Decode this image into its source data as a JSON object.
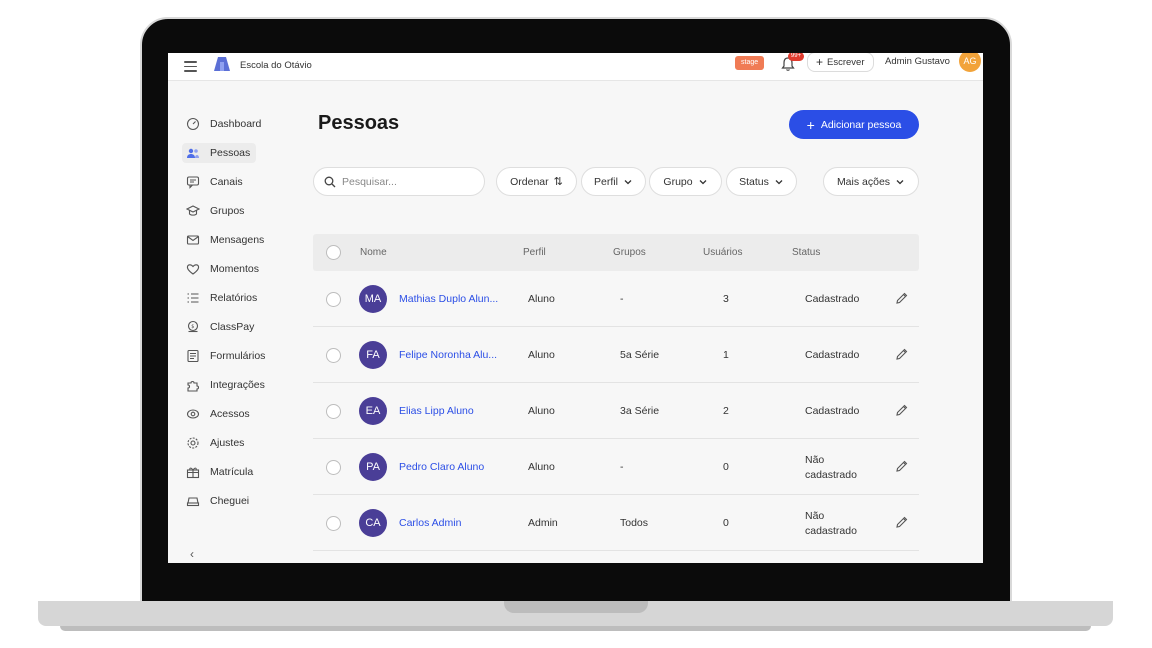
{
  "topbar": {
    "school_name": "Escola do Otávio",
    "stage_label": "stage",
    "notifications_count": "99+",
    "write_label": "Escrever",
    "admin_name": "Admin Gustavo",
    "admin_initials": "AG"
  },
  "sidebar": {
    "items": [
      {
        "label": "Dashboard",
        "icon": "dashboard-icon"
      },
      {
        "label": "Pessoas",
        "icon": "people-icon"
      },
      {
        "label": "Canais",
        "icon": "channels-icon"
      },
      {
        "label": "Grupos",
        "icon": "graduation-cap-icon"
      },
      {
        "label": "Mensagens",
        "icon": "mail-icon"
      },
      {
        "label": "Momentos",
        "icon": "heart-icon"
      },
      {
        "label": "Relatórios",
        "icon": "list-icon"
      },
      {
        "label": "ClassPay",
        "icon": "coin-icon"
      },
      {
        "label": "Formulários",
        "icon": "form-icon"
      },
      {
        "label": "Integrações",
        "icon": "puzzle-icon"
      },
      {
        "label": "Acessos",
        "icon": "access-icon"
      },
      {
        "label": "Ajustes",
        "icon": "gear-icon"
      },
      {
        "label": "Matrícula",
        "icon": "gift-icon"
      },
      {
        "label": "Cheguei",
        "icon": "car-icon"
      }
    ],
    "collapse_label": "‹"
  },
  "main": {
    "title": "Pessoas",
    "add_button": "Adicionar pessoa",
    "search_placeholder": "Pesquisar...",
    "filters": {
      "order": "Ordenar",
      "profile": "Perfil",
      "group": "Grupo",
      "status": "Status",
      "more": "Mais ações"
    }
  },
  "table": {
    "columns": {
      "name": "Nome",
      "profile": "Perfil",
      "groups": "Grupos",
      "users": "Usuários",
      "status": "Status"
    },
    "rows": [
      {
        "initials": "MA",
        "name": "Mathias Duplo Alun...",
        "profile": "Aluno",
        "group": "-",
        "users": "3",
        "status": "Cadastrado"
      },
      {
        "initials": "FA",
        "name": "Felipe Noronha Alu...",
        "profile": "Aluno",
        "group": "5a Série",
        "users": "1",
        "status": "Cadastrado"
      },
      {
        "initials": "EA",
        "name": "Elias Lipp Aluno",
        "profile": "Aluno",
        "group": "3a Série",
        "users": "2",
        "status": "Cadastrado"
      },
      {
        "initials": "PA",
        "name": "Pedro Claro Aluno",
        "profile": "Aluno",
        "group": "-",
        "users": "0",
        "status": "Não cadastrado"
      },
      {
        "initials": "CA",
        "name": "Carlos Admin",
        "profile": "Admin",
        "group": "Todos",
        "users": "0",
        "status": "Não cadastrado"
      }
    ]
  },
  "colors": {
    "accent": "#2b4ee6",
    "avatar": "#4a3e97",
    "stage": "#f07b55",
    "notification": "#e03b2e",
    "admin_avatar": "#f2a33a"
  }
}
